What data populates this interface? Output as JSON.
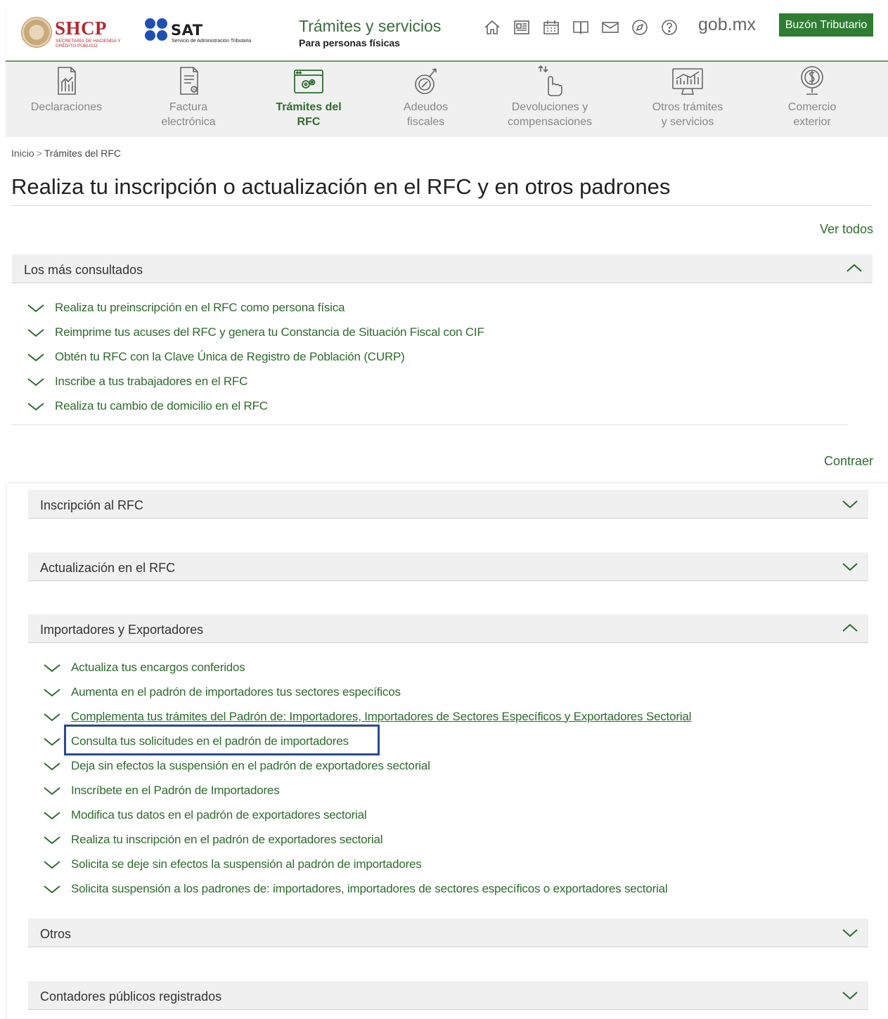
{
  "header": {
    "shcp_name": "SHCP",
    "shcp_sub": "SECRETARÍA DE HACIENDA Y CRÉDITO PÚBLICO",
    "sat_name": "SAT",
    "sat_sub": "Servicio de Administración Tributaria",
    "title": "Trámites y servicios",
    "subtitle": "Para personas físicas",
    "icons": [
      "home-icon",
      "newspaper-icon",
      "calendar-icon",
      "book-icon",
      "mail-icon",
      "compass-icon",
      "help-icon"
    ],
    "gob": "gob.mx",
    "buzon_label": "Buzón Tributario"
  },
  "nav": {
    "items": [
      {
        "label": "Declaraciones",
        "icon": "declaraciones-icon"
      },
      {
        "label": "Factura\nelectrónica",
        "icon": "factura-icon"
      },
      {
        "label": "Trámites del\nRFC",
        "icon": "rfc-icon",
        "active": true
      },
      {
        "label": "Adeudos\nfiscales",
        "icon": "adeudos-icon"
      },
      {
        "label": "Devoluciones y\ncompensaciones",
        "icon": "devoluciones-icon"
      },
      {
        "label": "Otros trámites\ny servicios",
        "icon": "otros-icon"
      },
      {
        "label": "Comercio\nexterior",
        "icon": "comercio-icon"
      }
    ]
  },
  "breadcrumb": {
    "home": "Inicio",
    "separator": ">",
    "current": "Trámites del RFC"
  },
  "page_title": "Realiza tu inscripción o actualización en el RFC y en otros padrones",
  "ver_todos": "Ver todos",
  "contraer": "Contraer",
  "mas_consultados": {
    "label": "Los más consultados",
    "expanded": true,
    "items": [
      "Realiza tu preinscripción en el RFC como persona física",
      "Reimprime tus acuses del RFC y genera tu Constancia de Situación Fiscal con CIF",
      "Obtén tu RFC con la Clave Única de Registro de Población (CURP)",
      "Inscribe a tus trabajadores en el RFC",
      "Realiza tu cambio de domicilio en el RFC"
    ]
  },
  "sections": {
    "inscripcion": {
      "label": "Inscripción al RFC",
      "expanded": false
    },
    "actualizacion": {
      "label": "Actualización en el RFC",
      "expanded": false
    },
    "importadores": {
      "label": "Importadores y Exportadores",
      "expanded": true,
      "items": [
        "Actualiza tus encargos conferidos",
        "Aumenta en el padrón de importadores tus sectores específicos",
        "Complementa tus trámites del Padrón de: Importadores, Importadores de Sectores Específicos y Exportadores Sectorial",
        "Consulta tus solicitudes en el padrón de importadores",
        "Deja sin efectos la suspensión en el padrón de exportadores sectorial",
        "Inscríbete en el Padrón de Importadores",
        "Modifica tus datos en el padrón de exportadores sectorial",
        "Realiza tu inscripción en el padrón de exportadores sectorial",
        "Solicita se deje sin efectos la suspensión al padrón de importadores",
        "Solicita suspensión a los padrones de: importadores, importadores de sectores específicos o exportadores sectorial"
      ],
      "highlighted_index": 3
    },
    "otros": {
      "label": "Otros",
      "expanded": false
    },
    "contadores": {
      "label": "Contadores públicos registrados",
      "expanded": false
    }
  },
  "colors": {
    "brand_green": "#2e6b2e",
    "button_green": "#2e7d32",
    "shcp_red": "#b3282d",
    "sat_blue": "#1f4fb3",
    "highlight_blue": "#2b4a8f"
  }
}
